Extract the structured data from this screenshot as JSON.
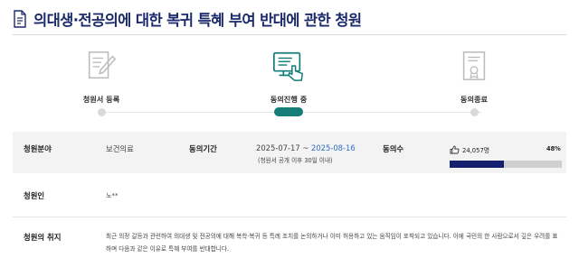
{
  "page": {
    "title": "의대생·전공의에 대한 복귀 특혜 부여 반대에 관한 청원",
    "title_icon": "document-icon",
    "accent_color": "#1b2a6b"
  },
  "steps": [
    {
      "label": "청원서 등록",
      "icon": "pen-document-icon",
      "active": false
    },
    {
      "label": "동의진행 중",
      "icon": "monitor-hand-icon",
      "active": true
    },
    {
      "label": "동의종료",
      "icon": "certificate-icon",
      "active": false
    }
  ],
  "active_color": "#157d78",
  "info": {
    "field_label": "청원분야",
    "field_value": "보건의료",
    "period_label": "동의기간",
    "period_start": "2025-07-17",
    "period_sep": " ~ ",
    "period_end": "2025-08-16",
    "period_note": "(청원서 공개 이후 30일 이내)",
    "agree_label": "동의수",
    "agree_count": "24,057명",
    "agree_icon": "thumbs-up-icon",
    "agree_percent_label": "48%",
    "agree_progress": 0.48
  },
  "petitioner": {
    "label": "청원인",
    "value": "노**"
  },
  "purpose": {
    "label": "청원의 취지",
    "text": "최근 의정 갈등과 관련하여 의대생 및 전공의에 대해 복학·복귀 등 특례 조치를 논의하거나 이미 허용하고 있는 움직임이 포착되고 있습니다. 이에 국민의 한 사람으로서 깊은 우려를 표하며 다음과 같은 이유로 특혜 부여를 반대합니다."
  }
}
